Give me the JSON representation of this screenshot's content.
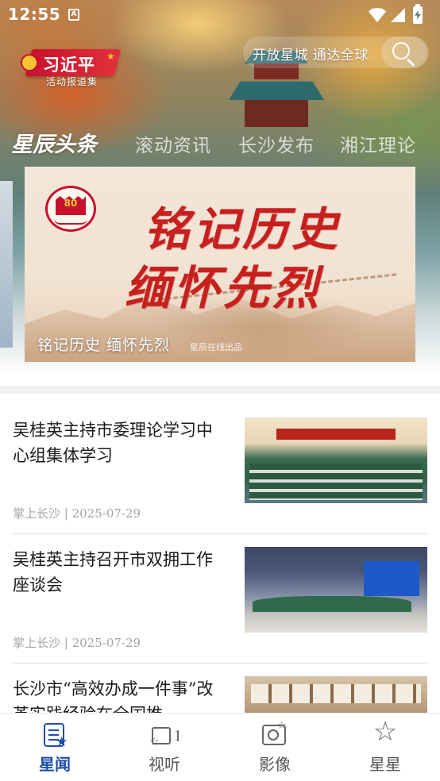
{
  "status_bar": {
    "time": "12:55",
    "notification_icon": "A"
  },
  "brand": {
    "name": "习近平",
    "subtitle": "活动报道集",
    "icon": "party-emblem-icon"
  },
  "search": {
    "placeholder": "开放星城 通达全球",
    "icon": "search-icon"
  },
  "tabs": [
    {
      "label": "星辰头条",
      "active": true
    },
    {
      "label": "滚动资讯",
      "active": false
    },
    {
      "label": "长沙发布",
      "active": false
    },
    {
      "label": "湘江理论",
      "active": false
    }
  ],
  "banner": {
    "badge_number": "80",
    "headline_line1": "铭记历史",
    "headline_line2": "缅怀先烈",
    "caption": "铭记历史 缅怀先烈",
    "credit": "星辰在线出品"
  },
  "news": [
    {
      "title": "吴桂英主持市委理论学习中心组集体学习",
      "meta": "掌上长沙 | 2025-07-29",
      "image_desc": "meeting-hall-photo"
    },
    {
      "title": "吴桂英主持召开市双拥工作座谈会",
      "meta": "掌上长沙 | 2025-07-29",
      "image_desc": "conference-room-photo"
    },
    {
      "title": "长沙市“高效办成一件事”改革实践经验在全国推",
      "meta": "",
      "image_desc": "service-hall-photo"
    }
  ],
  "bottom_nav": [
    {
      "label": "星闻",
      "icon": "news-star-icon",
      "active": true
    },
    {
      "label": "视听",
      "icon": "video-camera-icon",
      "active": false
    },
    {
      "label": "影像",
      "icon": "photo-camera-icon",
      "active": false
    },
    {
      "label": "星星",
      "icon": "star-icon",
      "active": false
    }
  ],
  "colors": {
    "accent": "#1f4fa8",
    "headline_red": "#c81f1f",
    "meta_gray": "#a3a3a3"
  }
}
